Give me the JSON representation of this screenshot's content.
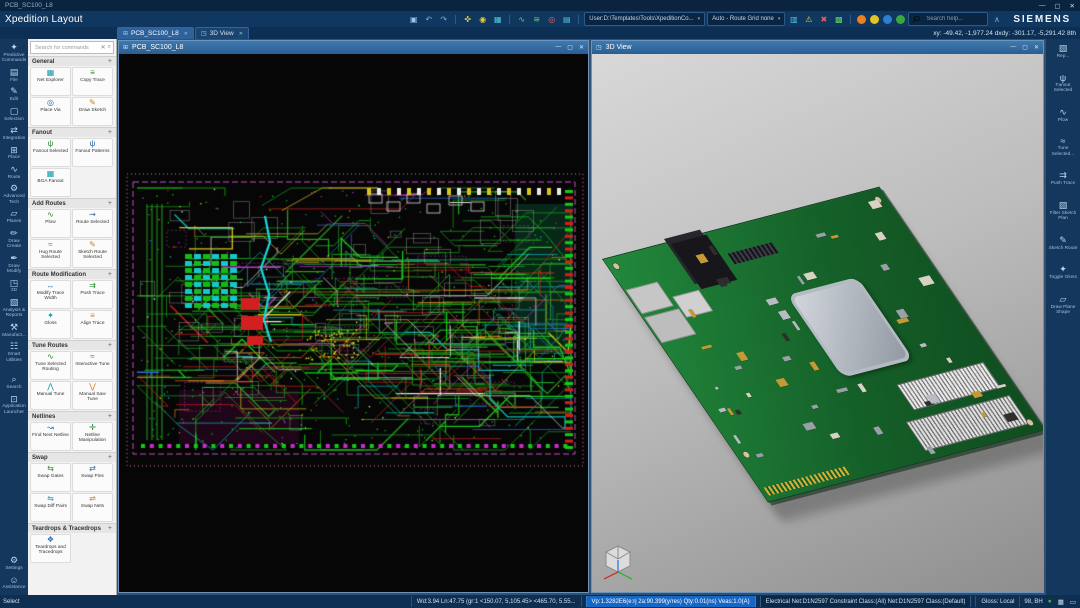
{
  "glyphs": {
    "min": "—",
    "max": "▢",
    "close": "✕",
    "caret": "▾",
    "plus": "+",
    "search": "⌕",
    "clear": "✕",
    "collapse": "∧"
  },
  "window": {
    "titlebar_text": "PCB_SC100_L8",
    "product": "Xpedition Layout",
    "brand": "SIEMENS"
  },
  "toolbar": {
    "icons_left": [
      {
        "name": "save-icon",
        "glyph": "▣"
      },
      {
        "name": "undo-icon",
        "glyph": "↶"
      },
      {
        "name": "redo-icon",
        "glyph": "↷"
      },
      {
        "name": "pin-icon",
        "glyph": "✜"
      },
      {
        "name": "lock-icon",
        "glyph": "◉"
      },
      {
        "name": "select-filter-icon",
        "glyph": "▦"
      },
      {
        "name": "route-mode-icon",
        "glyph": "∿"
      },
      {
        "name": "plow-icon",
        "glyph": "≋"
      },
      {
        "name": "via-icon",
        "glyph": "◎"
      },
      {
        "name": "layers-icon",
        "glyph": "▤"
      }
    ],
    "user_path": "User:D:\\Templates\\Tools\\XpeditionCo...",
    "grid_mode": "Auto - Route Grid none",
    "icons_right": [
      {
        "name": "display-control-icon",
        "glyph": "▥"
      },
      {
        "name": "warning-icon",
        "glyph": "⚠"
      },
      {
        "name": "delete-icon",
        "glyph": "✖"
      },
      {
        "name": "grid-toggle-icon",
        "glyph": "▩"
      }
    ],
    "circles": [
      {
        "name": "status-orange-button",
        "color": "#e8821e"
      },
      {
        "name": "status-yellow-button",
        "color": "#e4c41e"
      },
      {
        "name": "status-blue-button",
        "color": "#2f7fd0"
      },
      {
        "name": "status-green-button",
        "color": "#3aa83a"
      }
    ],
    "search_placeholder": "Search help..."
  },
  "tabbar": {
    "tabs": [
      {
        "glyph": "⊞",
        "label": "PCB_SC100_L8"
      },
      {
        "glyph": "◳",
        "label": "3D View"
      }
    ],
    "coords": "xy: -49.42, -1,977.24    dxdy: -301.17, -5,291.42    8th"
  },
  "left_rail": [
    {
      "glyph": "✦",
      "label": "Predictive Commands"
    },
    {
      "glyph": "▤",
      "label": "File"
    },
    {
      "glyph": "✎",
      "label": "Edit"
    },
    {
      "glyph": "▢",
      "label": "Selection"
    },
    {
      "glyph": "⇄",
      "label": "Integration"
    },
    {
      "glyph": "⊞",
      "label": "Place"
    },
    {
      "glyph": "∿",
      "label": "Route"
    },
    {
      "glyph": "⚙",
      "label": "Advanced Tech"
    },
    {
      "glyph": "▱",
      "label": "Planes"
    },
    {
      "glyph": "✏",
      "label": "Draw Create"
    },
    {
      "glyph": "✒",
      "label": "Draw Modify"
    },
    {
      "glyph": "◳",
      "label": "3D"
    },
    {
      "glyph": "▧",
      "label": "Analysis & Reports"
    },
    {
      "glyph": "⚒",
      "label": "Manufact..."
    },
    {
      "glyph": "☷",
      "label": "Smart Utilities"
    },
    {
      "glyph": "⌕",
      "label": "Search"
    },
    {
      "glyph": "⊡",
      "label": "Application Launcher"
    },
    {
      "glyph": "⚙",
      "label": "Settings"
    },
    {
      "glyph": "☺",
      "label": "Assistance"
    }
  ],
  "command_panel": {
    "search_placeholder": "Search for commands",
    "sections": [
      {
        "title": "General",
        "items": [
          {
            "glyph": "▦",
            "label": "Net Explorer"
          },
          {
            "glyph": "≡",
            "label": "Copy Trace"
          },
          {
            "glyph": "◎",
            "label": "Place Via"
          },
          {
            "glyph": "✎",
            "label": "Draw Sketch"
          }
        ]
      },
      {
        "title": "Fanout",
        "items": [
          {
            "glyph": "ψ",
            "label": "Fanout Selected"
          },
          {
            "glyph": "ψ",
            "label": "Fanout Patterns"
          },
          {
            "glyph": "▦",
            "label": "BGA Fanout"
          }
        ]
      },
      {
        "title": "Add Routes",
        "items": [
          {
            "glyph": "∿",
            "label": "Plow"
          },
          {
            "glyph": "⇝",
            "label": "Route Selected"
          },
          {
            "glyph": "≈",
            "label": "Hug Route Selected"
          },
          {
            "glyph": "✎",
            "label": "Sketch Route Selected"
          }
        ]
      },
      {
        "title": "Route Modification",
        "items": [
          {
            "glyph": "↔",
            "label": "Modify Trace Width"
          },
          {
            "glyph": "⇉",
            "label": "Push Trace"
          },
          {
            "glyph": "✦",
            "label": "Gloss"
          },
          {
            "glyph": "≡",
            "label": "Align Trace"
          }
        ]
      },
      {
        "title": "Tune Routes",
        "items": [
          {
            "glyph": "∿",
            "label": "Tune Selected Routing"
          },
          {
            "glyph": "≈",
            "label": "Interactive Tune"
          },
          {
            "glyph": "⋀",
            "label": "Manual Tune"
          },
          {
            "glyph": "⋁",
            "label": "Manual Saw Tune"
          }
        ]
      },
      {
        "title": "Netlines",
        "items": [
          {
            "glyph": "↝",
            "label": "Find Next Netline"
          },
          {
            "glyph": "✛",
            "label": "Netline Manipulation"
          }
        ]
      },
      {
        "title": "Swap",
        "items": [
          {
            "glyph": "⇆",
            "label": "Swap Gates"
          },
          {
            "glyph": "⇄",
            "label": "Swap Pins"
          },
          {
            "glyph": "⇋",
            "label": "Swap Diff Pairs"
          },
          {
            "glyph": "⇌",
            "label": "Swap Nets"
          }
        ]
      },
      {
        "title": "Teardrops & Tracedrops",
        "items": [
          {
            "glyph": "❖",
            "label": "Teardrops and Tracedrops"
          }
        ]
      }
    ]
  },
  "mdi": {
    "pcb_title": "PCB_SC100_L8",
    "view3d_title": "3D View"
  },
  "right_rail": [
    {
      "glyph": "▧",
      "label": "Rep..."
    },
    {
      "glyph": "ψ",
      "label": "Fanout Selected"
    },
    {
      "glyph": "∿",
      "label": "Plow"
    },
    {
      "glyph": "≈",
      "label": "Tune Selected..."
    },
    {
      "glyph": "⇉",
      "label": "Push Trace"
    },
    {
      "glyph": "▨",
      "label": "Filter Sketch Plan"
    },
    {
      "glyph": "✎",
      "label": "Sketch Route"
    },
    {
      "glyph": "✦",
      "label": "Toggle Gloss"
    },
    {
      "glyph": "▱",
      "label": "Draw Plane Shape"
    }
  ],
  "status_bar": {
    "mode": "Select",
    "dims": "Wd:3.94 Ln:47.75 (gr:1 <150.07, 5,105.45> <465.70, 5.55...",
    "props": "Vp:1.3282E6(e:rj 2a:90.399(y/res) Qty:0.01(ns) Veas:1.0(A)",
    "net": "Electrical Net:D1N2597 Constraint Class:(All) Net:D1N2597 Class:(Default)",
    "gloss": "Gloss: Local",
    "right_text": "98, BH",
    "icons": [
      {
        "name": "status-ok-icon",
        "glyph": "●"
      },
      {
        "name": "panel-grid-icon",
        "glyph": "▦"
      },
      {
        "name": "monitor-icon",
        "glyph": "▭"
      }
    ]
  },
  "artwork": {
    "canvas_bg": "#060606",
    "board_outline": "#c050c0",
    "frame_dotted": "#e06aaa",
    "trace_colors": [
      "#1f9e1f",
      "#17c917",
      "#0fb4b4",
      "#d22020",
      "#cc2bcc",
      "#d6c31e",
      "#2b6fd6",
      "#e8e8e8",
      "#d97b1e"
    ],
    "board3d_green": "#17692d"
  }
}
